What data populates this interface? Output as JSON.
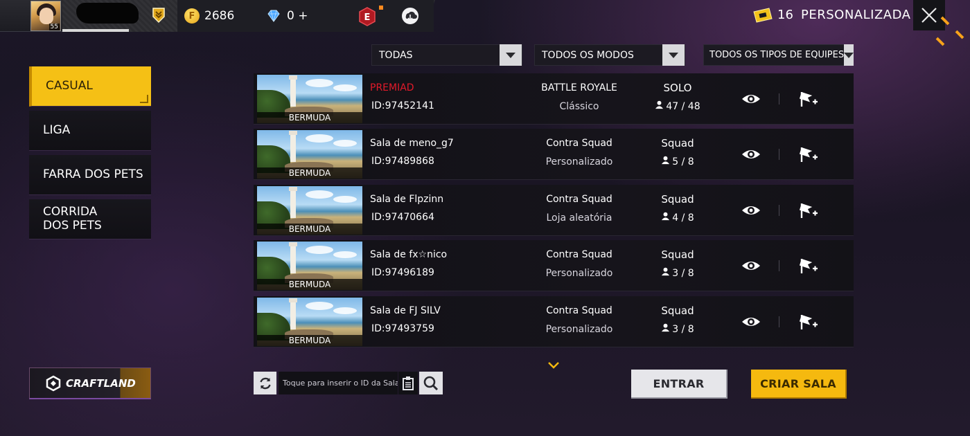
{
  "header": {
    "player_level": "55",
    "coins": "2686",
    "diamonds": "0",
    "diamonds_plus": "+",
    "tickets": "16",
    "page_title": "PERSONALIZADA"
  },
  "filters": [
    {
      "label": "TODAS"
    },
    {
      "label": "TODOS OS MODOS"
    },
    {
      "label": "TODOS OS TIPOS DE EQUIPES"
    }
  ],
  "categories": [
    {
      "label": "CASUAL",
      "active": true
    },
    {
      "label": "LIGA",
      "active": false
    },
    {
      "label": "FARRA DOS PETS",
      "active": false
    },
    {
      "label": "CORRIDA DOS PETS",
      "active": false
    }
  ],
  "craftland_label": "CRAFTLAND",
  "rooms": [
    {
      "map": "BERMUDA",
      "title": "PREMIAD",
      "id": "ID:97452141",
      "mode": "BATTLE ROYALE",
      "submode": "Clássico",
      "team": "SOLO",
      "players": "47 / 48"
    },
    {
      "map": "BERMUDA",
      "title": "Sala de meno_g7",
      "id": "ID:97489868",
      "mode": "Contra Squad",
      "submode": "Personalizado",
      "team": "Squad",
      "players": "5 / 8"
    },
    {
      "map": "BERMUDA",
      "title": "Sala de Flpzinn",
      "id": "ID:97470664",
      "mode": "Contra Squad",
      "submode": "Loja aleatória",
      "team": "Squad",
      "players": "4 / 8"
    },
    {
      "map": "BERMUDA",
      "title": "Sala de fx☆nico",
      "id": "ID:97496189",
      "mode": "Contra Squad",
      "submode": "Personalizado",
      "team": "Squad",
      "players": "3 / 8"
    },
    {
      "map": "BERMUDA",
      "title": "Sala de FJ    SILV",
      "id": "ID:97493759",
      "mode": "Contra Squad",
      "submode": "Personalizado",
      "team": "Squad",
      "players": "3 / 8"
    }
  ],
  "search": {
    "placeholder": "Toque para inserir o ID da Sala"
  },
  "buttons": {
    "enter": "ENTRAR",
    "create": "CRIAR SALA"
  },
  "colors": {
    "accent_yellow": "#f5c015",
    "premium_red": "#e21a2a",
    "background": "#1b1726"
  }
}
